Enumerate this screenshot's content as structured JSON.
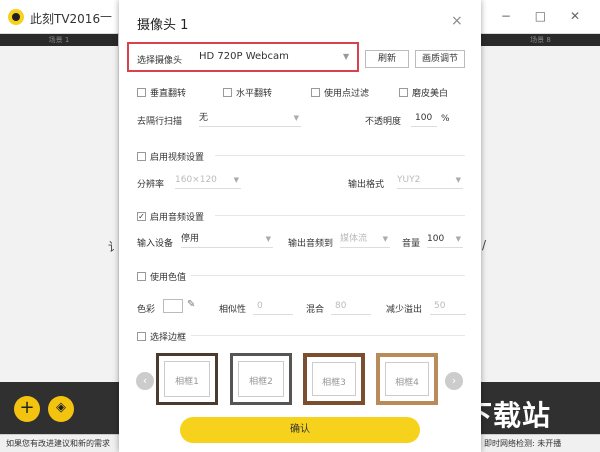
{
  "app": {
    "title": "此刻TV2016",
    "dash": "—",
    "scene_left": "场景 1",
    "scene_right": "场景 8",
    "side_left": "讠",
    "side_right": "/",
    "window_controls": "⚙ − □ ✕",
    "add_icon": "+",
    "layers_icon": "◈",
    "status_left": "如果您有改进建议和新的需求",
    "status_right": "即时网络检测: 未开播",
    "watermark": "极速下载站"
  },
  "dialog": {
    "title": "摄像头 1",
    "close": "×",
    "camera_label": "选择摄像头",
    "camera_value": "HD 720P Webcam",
    "refresh": "刷新",
    "quality": "画质调节",
    "flip_vertical": "垂直翻转",
    "flip_horizontal": "水平翻转",
    "use_filter": "使用点过滤",
    "beauty": "磨皮美白",
    "deinterlace_label": "去隔行扫描",
    "deinterlace_value": "无",
    "opacity_label": "不透明度",
    "opacity_value": "100",
    "opacity_unit": "%",
    "enable_video": "启用视频设置",
    "resolution_label": "分辨率",
    "resolution_value": "160×120",
    "output_format_label": "输出格式",
    "output_format_value": "YUY2",
    "enable_audio": "启用音频设置",
    "input_device_label": "输入设备",
    "input_device_value": "停用",
    "output_audio_label": "输出音频到",
    "output_audio_value": "媒体流",
    "volume_label": "音量",
    "volume_value": "100",
    "use_color": "使用色值",
    "color_label": "色彩",
    "similarity_label": "相似性",
    "similarity_value": "0",
    "blend_label": "混合",
    "blend_value": "80",
    "spill_label": "减少溢出",
    "spill_value": "50",
    "select_frame": "选择边框",
    "frames": [
      "相框1",
      "相框2",
      "相框3",
      "相框4"
    ],
    "confirm": "确认"
  },
  "colors": {
    "accent_yellow": "#f7d21c",
    "highlight_red": "#d9414e"
  }
}
